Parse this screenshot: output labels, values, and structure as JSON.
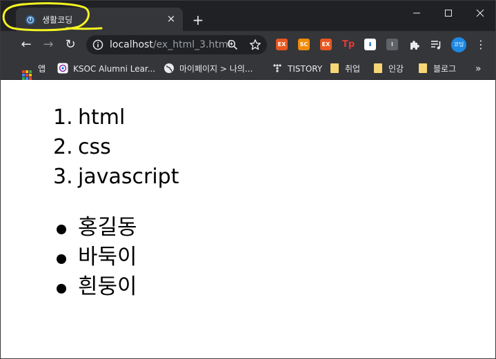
{
  "tab": {
    "title": "생활코딩",
    "close_label": "×",
    "new_tab_label": "+"
  },
  "window_controls": {
    "minimize": "—",
    "maximize": "☐",
    "close": "✕"
  },
  "toolbar": {
    "back": "←",
    "forward": "→",
    "reload": "↻",
    "url_host": "localhost",
    "url_path": "/ex_html_3.html",
    "extensions": [
      "EX",
      "SC",
      "EX",
      "Tp",
      "",
      "I"
    ],
    "profile_label": "코딩",
    "menu": "⋮"
  },
  "bookmarks": {
    "items": [
      {
        "label": "앱",
        "icon": "apps-grid-icon"
      },
      {
        "label": "KSOC Alumni Lear...",
        "icon": "ksoc-icon"
      },
      {
        "label": "마이페이지 > 나의...",
        "icon": "globe-icon"
      },
      {
        "label": "TISTORY",
        "icon": "tistory-icon"
      },
      {
        "label": "취업",
        "icon": "folder-icon"
      },
      {
        "label": "인강",
        "icon": "folder-icon"
      },
      {
        "label": "블로그",
        "icon": "folder-icon"
      }
    ],
    "more": "»"
  },
  "content": {
    "ordered_list": [
      {
        "num": "1.",
        "text": "html"
      },
      {
        "num": "2.",
        "text": "css"
      },
      {
        "num": "3.",
        "text": "javascript"
      }
    ],
    "unordered_list": [
      {
        "text": "홍길동"
      },
      {
        "text": "바둑이"
      },
      {
        "text": "흰둥이"
      }
    ]
  },
  "colors": {
    "tabbar_bg": "#202124",
    "toolbar_bg": "#35363a",
    "highlight": "#f5f522"
  }
}
